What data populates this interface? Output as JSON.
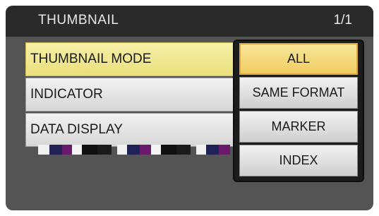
{
  "header": {
    "title": "THUMBNAIL",
    "page": "1/1"
  },
  "menu": {
    "items": [
      {
        "label": "THUMBNAIL MODE"
      },
      {
        "label": "INDICATOR"
      },
      {
        "label": "DATA DISPLAY"
      }
    ]
  },
  "submenu": {
    "options": [
      {
        "label": "ALL"
      },
      {
        "label": "SAME FORMAT"
      },
      {
        "label": "MARKER"
      },
      {
        "label": "INDEX"
      }
    ]
  },
  "colors": {
    "screen_bg": "#545454",
    "header_bg": "#2a2a2a",
    "menu_selected": "#f0e68c",
    "submenu_selected": "#f4d47a"
  }
}
